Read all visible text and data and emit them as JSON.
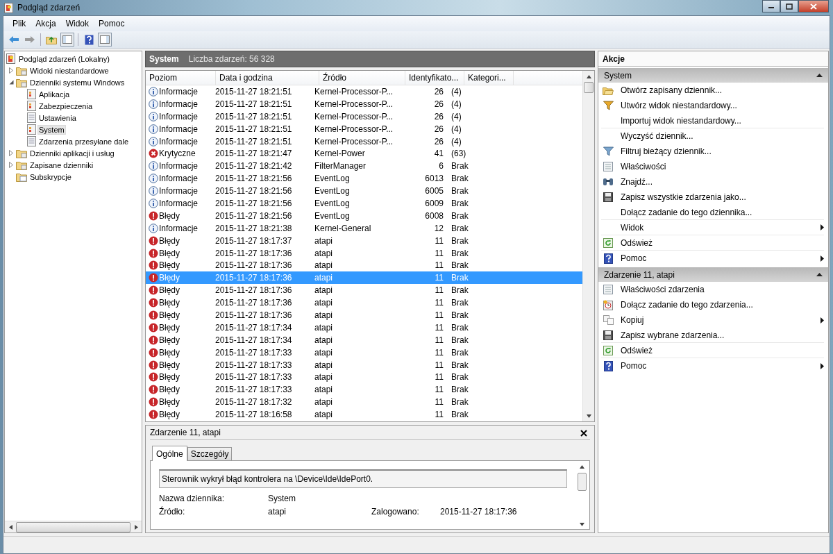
{
  "window": {
    "title": "Podgląd zdarzeń"
  },
  "menu": [
    {
      "label": "Plik"
    },
    {
      "label": "Akcja"
    },
    {
      "label": "Widok"
    },
    {
      "label": "Pomoc"
    }
  ],
  "tree": [
    {
      "label": "Podgląd zdarzeń (Lokalny)",
      "kind": "root",
      "selected": false,
      "children": [
        {
          "label": "Widoki niestandardowe",
          "kind": "folder",
          "expanded": false,
          "selected": false
        },
        {
          "label": "Dzienniki systemu Windows",
          "kind": "folder",
          "expanded": true,
          "selected": false,
          "children": [
            {
              "label": "Aplikacja",
              "kind": "log",
              "selected": false
            },
            {
              "label": "Zabezpieczenia",
              "kind": "log",
              "selected": false
            },
            {
              "label": "Ustawienia",
              "kind": "page",
              "selected": false
            },
            {
              "label": "System",
              "kind": "log",
              "selected": true
            },
            {
              "label": "Zdarzenia przesyłane dale",
              "kind": "page",
              "selected": false
            }
          ]
        },
        {
          "label": "Dzienniki aplikacji i usług",
          "kind": "folder",
          "expanded": false,
          "selected": false
        },
        {
          "label": "Zapisane dzienniki",
          "kind": "folder",
          "expanded": false,
          "selected": false
        },
        {
          "label": "Subskrypcje",
          "kind": "subscriptions",
          "selected": false
        }
      ]
    }
  ],
  "log_header": {
    "title": "System",
    "count": "Liczba zdarzeń: 56 328"
  },
  "table": {
    "columns": [
      "Poziom",
      "Data i godzina",
      "Źródło",
      "Identyfikato...",
      "Kategori..."
    ],
    "rows": [
      {
        "kind": "info",
        "severity": "Informacje",
        "date": "2015-11-27 18:21:51",
        "source": "Kernel-Processor-P...",
        "event_id": "26",
        "category": "(4)",
        "selected": false
      },
      {
        "kind": "info",
        "severity": "Informacje",
        "date": "2015-11-27 18:21:51",
        "source": "Kernel-Processor-P...",
        "event_id": "26",
        "category": "(4)",
        "selected": false
      },
      {
        "kind": "info",
        "severity": "Informacje",
        "date": "2015-11-27 18:21:51",
        "source": "Kernel-Processor-P...",
        "event_id": "26",
        "category": "(4)",
        "selected": false
      },
      {
        "kind": "info",
        "severity": "Informacje",
        "date": "2015-11-27 18:21:51",
        "source": "Kernel-Processor-P...",
        "event_id": "26",
        "category": "(4)",
        "selected": false
      },
      {
        "kind": "info",
        "severity": "Informacje",
        "date": "2015-11-27 18:21:51",
        "source": "Kernel-Processor-P...",
        "event_id": "26",
        "category": "(4)",
        "selected": false
      },
      {
        "kind": "critical",
        "severity": "Krytyczne",
        "date": "2015-11-27 18:21:47",
        "source": "Kernel-Power",
        "event_id": "41",
        "category": "(63)",
        "selected": false
      },
      {
        "kind": "info",
        "severity": "Informacje",
        "date": "2015-11-27 18:21:42",
        "source": "FilterManager",
        "event_id": "6",
        "category": "Brak",
        "selected": false
      },
      {
        "kind": "info",
        "severity": "Informacje",
        "date": "2015-11-27 18:21:56",
        "source": "EventLog",
        "event_id": "6013",
        "category": "Brak",
        "selected": false
      },
      {
        "kind": "info",
        "severity": "Informacje",
        "date": "2015-11-27 18:21:56",
        "source": "EventLog",
        "event_id": "6005",
        "category": "Brak",
        "selected": false
      },
      {
        "kind": "info",
        "severity": "Informacje",
        "date": "2015-11-27 18:21:56",
        "source": "EventLog",
        "event_id": "6009",
        "category": "Brak",
        "selected": false
      },
      {
        "kind": "error",
        "severity": "Błędy",
        "date": "2015-11-27 18:21:56",
        "source": "EventLog",
        "event_id": "6008",
        "category": "Brak",
        "selected": false
      },
      {
        "kind": "info",
        "severity": "Informacje",
        "date": "2015-11-27 18:21:38",
        "source": "Kernel-General",
        "event_id": "12",
        "category": "Brak",
        "selected": false
      },
      {
        "kind": "error",
        "severity": "Błędy",
        "date": "2015-11-27 18:17:37",
        "source": "atapi",
        "event_id": "11",
        "category": "Brak",
        "selected": false
      },
      {
        "kind": "error",
        "severity": "Błędy",
        "date": "2015-11-27 18:17:36",
        "source": "atapi",
        "event_id": "11",
        "category": "Brak",
        "selected": false
      },
      {
        "kind": "error",
        "severity": "Błędy",
        "date": "2015-11-27 18:17:36",
        "source": "atapi",
        "event_id": "11",
        "category": "Brak",
        "selected": false
      },
      {
        "kind": "error",
        "severity": "Błędy",
        "date": "2015-11-27 18:17:36",
        "source": "atapi",
        "event_id": "11",
        "category": "Brak",
        "selected": true
      },
      {
        "kind": "error",
        "severity": "Błędy",
        "date": "2015-11-27 18:17:36",
        "source": "atapi",
        "event_id": "11",
        "category": "Brak",
        "selected": false
      },
      {
        "kind": "error",
        "severity": "Błędy",
        "date": "2015-11-27 18:17:36",
        "source": "atapi",
        "event_id": "11",
        "category": "Brak",
        "selected": false
      },
      {
        "kind": "error",
        "severity": "Błędy",
        "date": "2015-11-27 18:17:36",
        "source": "atapi",
        "event_id": "11",
        "category": "Brak",
        "selected": false
      },
      {
        "kind": "error",
        "severity": "Błędy",
        "date": "2015-11-27 18:17:34",
        "source": "atapi",
        "event_id": "11",
        "category": "Brak",
        "selected": false
      },
      {
        "kind": "error",
        "severity": "Błędy",
        "date": "2015-11-27 18:17:34",
        "source": "atapi",
        "event_id": "11",
        "category": "Brak",
        "selected": false
      },
      {
        "kind": "error",
        "severity": "Błędy",
        "date": "2015-11-27 18:17:33",
        "source": "atapi",
        "event_id": "11",
        "category": "Brak",
        "selected": false
      },
      {
        "kind": "error",
        "severity": "Błędy",
        "date": "2015-11-27 18:17:33",
        "source": "atapi",
        "event_id": "11",
        "category": "Brak",
        "selected": false
      },
      {
        "kind": "error",
        "severity": "Błędy",
        "date": "2015-11-27 18:17:33",
        "source": "atapi",
        "event_id": "11",
        "category": "Brak",
        "selected": false
      },
      {
        "kind": "error",
        "severity": "Błędy",
        "date": "2015-11-27 18:17:33",
        "source": "atapi",
        "event_id": "11",
        "category": "Brak",
        "selected": false
      },
      {
        "kind": "error",
        "severity": "Błędy",
        "date": "2015-11-27 18:17:32",
        "source": "atapi",
        "event_id": "11",
        "category": "Brak",
        "selected": false
      },
      {
        "kind": "error",
        "severity": "Błędy",
        "date": "2015-11-27 18:16:58",
        "source": "atapi",
        "event_id": "11",
        "category": "Brak",
        "selected": false
      }
    ]
  },
  "detail": {
    "title": "Zdarzenie 11, atapi",
    "tabs": [
      {
        "label": "Ogólne",
        "selected": true
      },
      {
        "label": "Szczegóły",
        "selected": false
      }
    ],
    "message": "Sterownik wykrył błąd kontrolera na \\Device\\Ide\\IdePort0.",
    "rows": [
      {
        "pairs": [
          {
            "label": "Nazwa dziennika:",
            "value": "System"
          }
        ]
      },
      {
        "pairs": [
          {
            "label": "Źródło:",
            "value": "atapi"
          },
          {
            "label": "Zalogowano:",
            "value": "2015-11-27 18:17:36"
          }
        ]
      }
    ]
  },
  "actions": {
    "title": "Akcje",
    "sections": [
      {
        "title": "System",
        "groups": [
          {
            "items": [
              {
                "label": "Otwórz zapisany dziennik...",
                "kind": "folder-open",
                "submenu": false
              },
              {
                "label": "Utwórz widok niestandardowy...",
                "kind": "funnel-star",
                "submenu": false
              },
              {
                "label": "Importuj widok niestandardowy...",
                "kind": "plain",
                "submenu": false
              }
            ]
          },
          {
            "items": [
              {
                "label": "Wyczyść dziennik...",
                "kind": "plain",
                "submenu": false
              },
              {
                "label": "Filtruj bieżący dziennik...",
                "kind": "funnel",
                "submenu": false
              },
              {
                "label": "Właściwości",
                "kind": "properties",
                "submenu": false
              },
              {
                "label": "Znajdź...",
                "kind": "binoculars",
                "submenu": false
              },
              {
                "label": "Zapisz wszystkie zdarzenia jako...",
                "kind": "disk",
                "submenu": false
              },
              {
                "label": "Dołącz zadanie do tego dziennika...",
                "kind": "plain",
                "submenu": false
              }
            ]
          },
          {
            "items": [
              {
                "label": "Widok",
                "kind": "plain",
                "submenu": true
              }
            ]
          },
          {
            "items": [
              {
                "label": "Odśwież",
                "kind": "refresh",
                "submenu": false
              }
            ]
          },
          {
            "items": [
              {
                "label": "Pomoc",
                "kind": "help",
                "submenu": true
              }
            ]
          }
        ]
      },
      {
        "title": "Zdarzenie 11, atapi",
        "groups": [
          {
            "items": [
              {
                "label": "Właściwości zdarzenia",
                "kind": "properties",
                "submenu": false
              },
              {
                "label": "Dołącz zadanie do tego zdarzenia...",
                "kind": "task",
                "submenu": false
              },
              {
                "label": "Kopiuj",
                "kind": "copy",
                "submenu": true
              },
              {
                "label": "Zapisz wybrane zdarzenia...",
                "kind": "disk",
                "submenu": false
              }
            ]
          },
          {
            "items": [
              {
                "label": "Odśwież",
                "kind": "refresh",
                "submenu": false
              }
            ]
          },
          {
            "items": [
              {
                "label": "Pomoc",
                "kind": "help",
                "submenu": true
              }
            ]
          }
        ]
      }
    ]
  }
}
